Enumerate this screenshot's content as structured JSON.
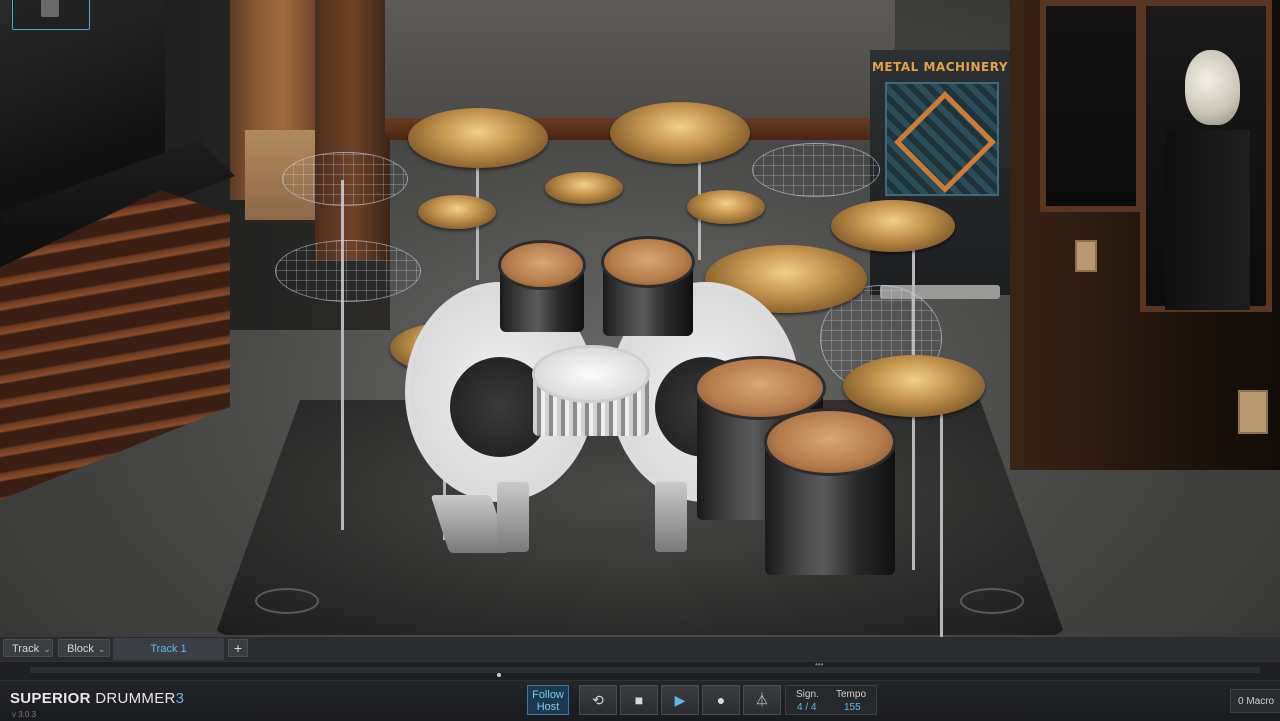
{
  "stage": {
    "banner_title": "METAL MACHINERY"
  },
  "trackbar": {
    "track_label": "Track",
    "block_label": "Block",
    "active_tab": "Track 1",
    "add_label": "+"
  },
  "footer": {
    "brand_bold": "SUPERIOR",
    "brand_thin": "DRUMMER",
    "brand_num": "3",
    "version": "v 3.0.3",
    "follow_host": "Follow Host",
    "sign_label": "Sign.",
    "sign_value": "4 / 4",
    "tempo_label": "Tempo",
    "tempo_value": "155",
    "macro_label": "0 Macro"
  },
  "icons": [
    "loop-icon",
    "stop-icon",
    "play-icon",
    "record-icon",
    "metronome-icon"
  ],
  "colors": {
    "accent": "#5fb8e8",
    "background": "#1a1b1d"
  }
}
